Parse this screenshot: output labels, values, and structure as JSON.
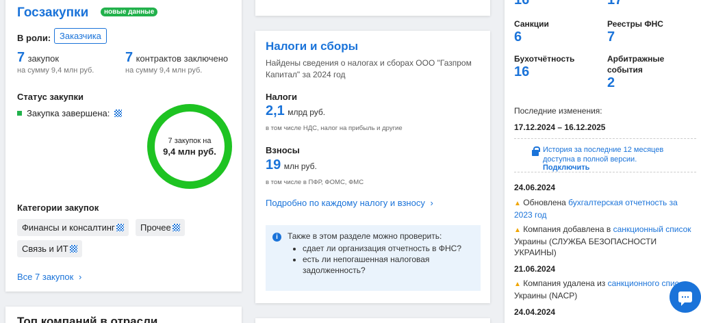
{
  "left": {
    "title": "Госзакупки",
    "badge": "новые данные",
    "role_label": "В роли:",
    "role_value": "Заказчика",
    "stats": [
      {
        "value": "7",
        "label": "закупок",
        "sub": "на сумму 9,4 млн руб."
      },
      {
        "value": "7",
        "label": "контрактов заключено",
        "sub": "на сумму 9,4 млн руб."
      }
    ],
    "status_title": "Статус закупки",
    "status_row": "Закупка завершена:",
    "ring_line1": "7 закупок на",
    "ring_line2": "9,4 млн руб.",
    "categories_title": "Категории закупок",
    "categories": [
      "Финансы и консалтинг",
      "Прочее",
      "Связь и ИТ"
    ],
    "all_link": "Все 7 закупок",
    "all_link_arrow": "›",
    "status_color": "#22b14c",
    "ring_color": "#1ec322"
  },
  "left2": {
    "title": "Топ компаний в отрасли"
  },
  "mid": {
    "title": "Налоги и сборы",
    "desc": "Найдены сведения о налогах и сборах ООО \"Газпром Капитал\" за 2024 год",
    "taxes_title": "Налоги",
    "taxes_value": "2,1",
    "taxes_unit": "млрд руб.",
    "taxes_note": "в том числе НДС, налог на прибыль и другие",
    "fees_title": "Взносы",
    "fees_value": "19",
    "fees_unit": "млн руб.",
    "fees_note": "в том числе в ПФР, ФОМС, ФМС",
    "detail_link": "Подробно по каждому налогу и взносу",
    "detail_arrow": "›",
    "info_icon": "i",
    "info_intro": "Также в этом разделе можно проверить:",
    "info_items": [
      "сдает ли организация отчетность в ФНС?",
      "есть ли непогашенная налоговая задолженность?"
    ]
  },
  "right": {
    "stats": [
      {
        "label": "Санкции",
        "value": "6"
      },
      {
        "label": "Реестры ФНС",
        "value": "7"
      },
      {
        "label": "Бухотчётность",
        "value": "16"
      },
      {
        "label": "Арбитражные события",
        "value": "2"
      }
    ],
    "changes_title": "Последние изменения:",
    "period": "17.12.2024 – 16.12.2025",
    "history_text": "История за последние 12 месяцев доступна в полной версии.",
    "history_link": "Подключить",
    "warn_icon": "▲",
    "events": [
      {
        "date": "24.06.2024",
        "pre": "Обновлена ",
        "link": "бухгалтерская отчетность за 2023 год",
        "post": ""
      },
      {
        "date": "",
        "pre": "Компания добавлена в ",
        "link": "санкционный список",
        "post": " Украины (СЛУЖБА БЕЗОПАСНОСТИ УКРАИНЫ)"
      },
      {
        "date": "21.06.2024",
        "pre": "Компания удалена из ",
        "link": "санкционного спис",
        "post": " Украины (NACP)"
      },
      {
        "date": "24.04.2024",
        "pre": "",
        "link": "",
        "post": ""
      }
    ]
  },
  "colors": {
    "accent": "#1a73d9",
    "warning": "#f0a500",
    "info_bg": "#eaf3fc"
  }
}
